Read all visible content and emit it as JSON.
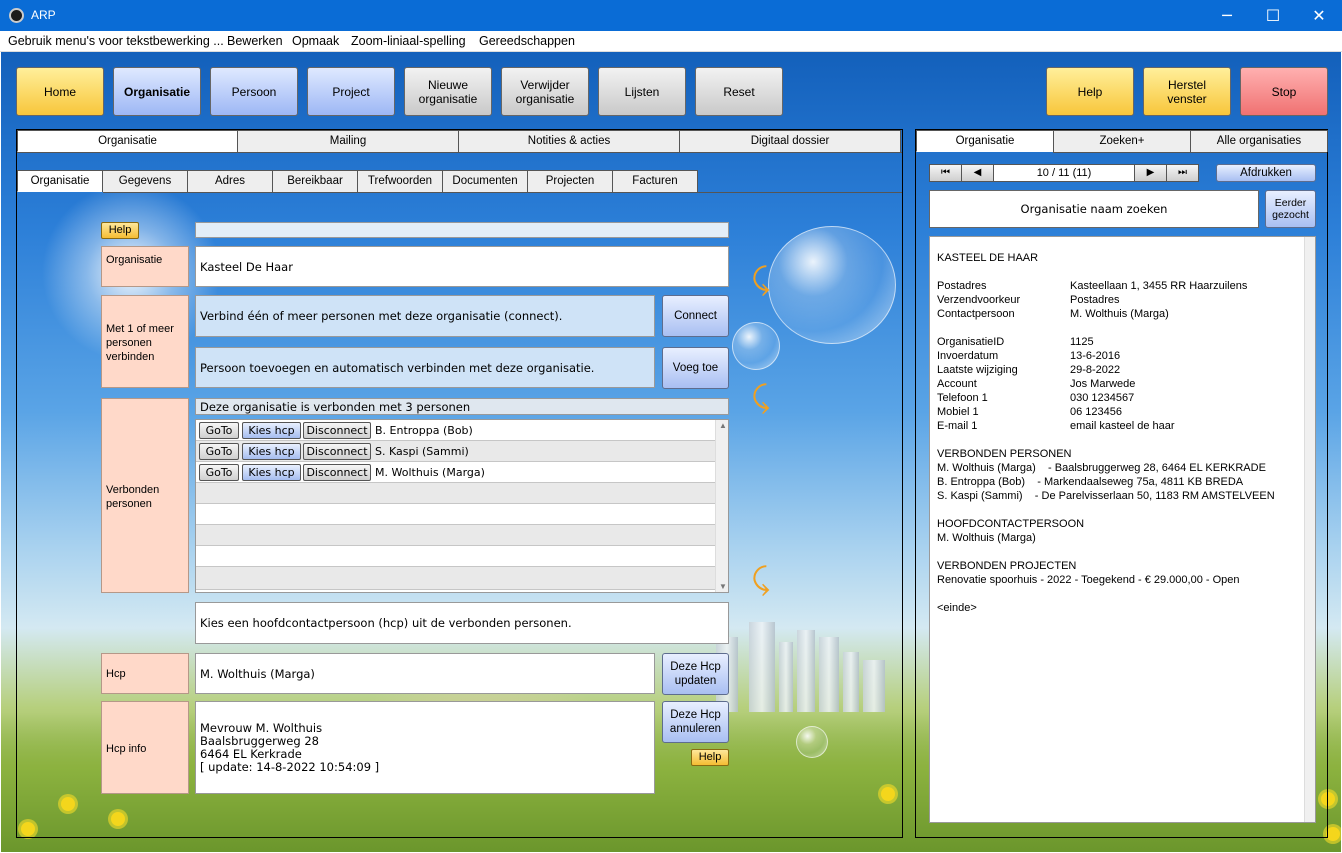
{
  "window": {
    "title": "ARP",
    "minimize_glyph": "─",
    "maximize_glyph": "☐",
    "close_glyph": "✕"
  },
  "menu": [
    "Gebruik menu's voor tekstbewerking ...",
    "Bewerken",
    "Opmaak",
    "Zoom-liniaal-spelling",
    "Gereedschappen"
  ],
  "toolbar": {
    "home": "Home",
    "organisatie": "Organisatie",
    "persoon": "Persoon",
    "project": "Project",
    "nieuwe_organisatie": "Nieuwe organisatie",
    "verwijder_organisatie": "Verwijder organisatie",
    "lijsten": "Lijsten",
    "reset": "Reset",
    "help": "Help",
    "herstel_venster": "Herstel venster",
    "stop": "Stop"
  },
  "main_tabs": [
    "Organisatie",
    "Mailing",
    "Notities & acties",
    "Digitaal dossier"
  ],
  "sub_tabs": [
    "Organisatie",
    "Gegevens",
    "Adres",
    "Bereikbaar",
    "Trefwoorden",
    "Documenten",
    "Projecten",
    "Facturen"
  ],
  "form": {
    "help_label": "Help",
    "organisatie_label": "Organisatie",
    "organisatie_value": "Kasteel De Haar",
    "connect_label": "Met 1 of meer personen verbinden",
    "connect_text": "Verbind één of meer personen met deze organisatie (connect).",
    "connect_button": "Connect",
    "add_text": "Persoon toevoegen en automatisch verbinden met deze organisatie.",
    "add_button": "Voeg toe",
    "verbonden_label": "Verbonden personen",
    "verbonden_header": "Deze organisatie is verbonden met 3 personen",
    "row_buttons": {
      "goto": "GoTo",
      "kies": "Kies hcp",
      "disconnect": "Disconnect"
    },
    "persons": [
      "B. Entroppa (Bob)",
      "S. Kaspi (Sammi)",
      "M. Wolthuis (Marga)"
    ],
    "hcp_instruction": "Kies een hoofdcontactpersoon (hcp) uit de verbonden personen.",
    "hcp_label": "Hcp",
    "hcp_value": "M. Wolthuis (Marga)",
    "hcp_update_button": "Deze Hcp updaten",
    "hcp_info_label": "Hcp info",
    "hcp_info_lines": [
      "Mevrouw M. Wolthuis",
      "Baalsbruggerweg 28",
      "6464 EL Kerkrade",
      "[ update: 14-8-2022 10:54:09 ]"
    ],
    "hcp_cancel_button": "Deze Hcp annuleren",
    "help_bottom": "Help"
  },
  "right": {
    "tabs": [
      "Organisatie",
      "Zoeken+",
      "Alle organisaties"
    ],
    "nav": {
      "first": "⏮",
      "prev": "◀",
      "position": "10 / 11 (11)",
      "next": "▶",
      "last": "⏭"
    },
    "afdrukken": "Afdrukken",
    "search_button": "Organisatie naam zoeken",
    "eerder_gezocht": "Eerder gezocht",
    "info_title": "KASTEEL DE HAAR",
    "block1": [
      {
        "k": "Postadres",
        "v": "Kasteellaan 1, 3455 RR Haarzuilens"
      },
      {
        "k": "Verzendvoorkeur",
        "v": "Postadres"
      },
      {
        "k": "Contactpersoon",
        "v": "M. Wolthuis (Marga)"
      }
    ],
    "block2": [
      {
        "k": "OrganisatieID",
        "v": "1125"
      },
      {
        "k": "Invoerdatum",
        "v": "13-6-2016"
      },
      {
        "k": "Laatste wijziging",
        "v": "29-8-2022"
      },
      {
        "k": "Account",
        "v": "Jos Marwede"
      },
      {
        "k": "Telefoon 1",
        "v": "030 1234567"
      },
      {
        "k": "Mobiel 1",
        "v": "06 123456"
      },
      {
        "k": "E-mail 1",
        "v": "email kasteel de haar"
      }
    ],
    "verbonden_title": "VERBONDEN PERSONEN",
    "verbonden_lines": [
      "M. Wolthuis (Marga)    - Baalsbruggerweg 28, 6464 EL KERKRADE",
      "B. Entroppa (Bob)    - Markendaalseweg 75a, 4811 KB BREDA",
      "S. Kaspi (Sammi)    - De Parelvisserlaan 50, 1183 RM AMSTELVEEN"
    ],
    "hcp_title": "HOOFDCONTACTPERSOON",
    "hcp_line": "M. Wolthuis (Marga)",
    "projecten_title": "VERBONDEN PROJECTEN",
    "projecten_line": "Renovatie spoorhuis - 2022 - Toegekend - € 29.000,00 - Open",
    "einde": "<einde>"
  }
}
